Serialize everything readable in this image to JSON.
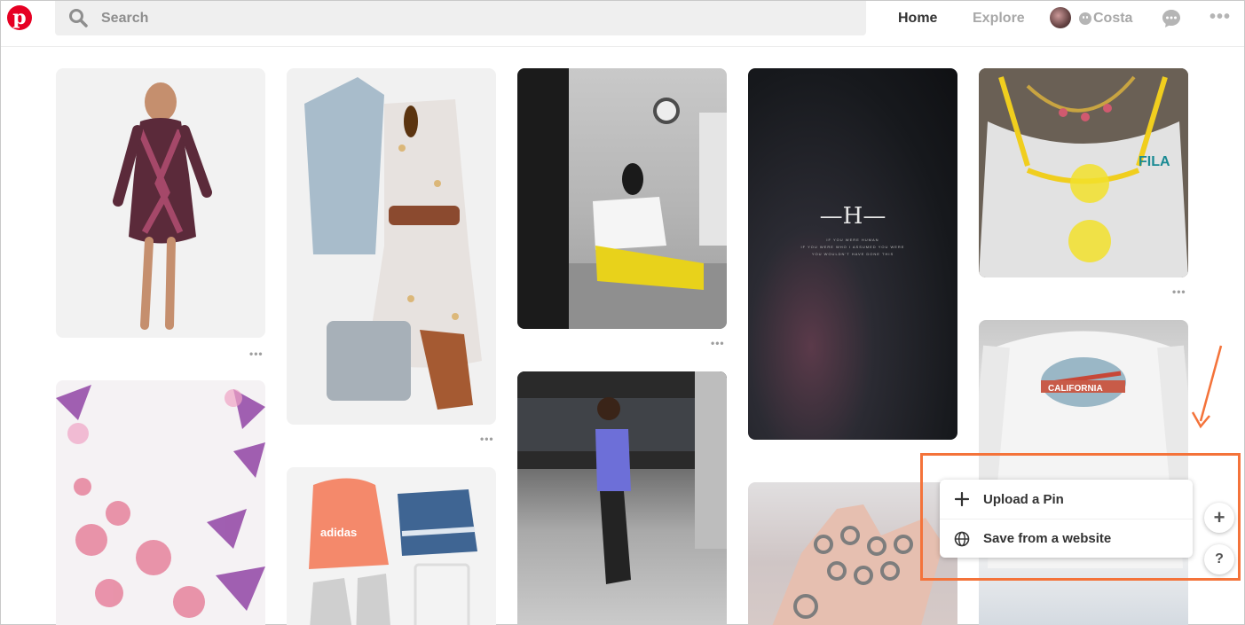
{
  "header": {
    "search_placeholder": "Search",
    "nav_home": "Home",
    "nav_explore": "Explore",
    "username": "Costa",
    "more": "•••"
  },
  "pins": {
    "overflow": "•••",
    "pin4_title": "—H—",
    "pin4_caption": "IF YOU WERE HUMAN\nIF YOU WERE WHO I ASSUMED YOU WERE\nYOU WOULDN'T HAVE DONE THIS"
  },
  "popup": {
    "upload_label": "Upload a Pin",
    "save_label": "Save from a website"
  },
  "fab": {
    "plus": "+",
    "help": "?"
  },
  "colors": {
    "brand": "#e60023",
    "annotation": "#f4733a"
  }
}
